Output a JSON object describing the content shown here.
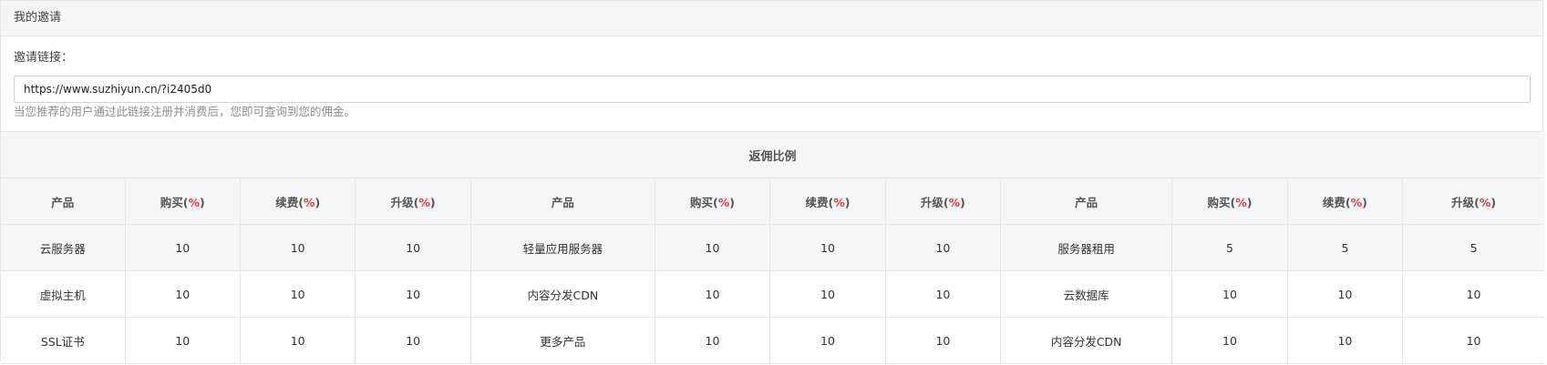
{
  "header": {
    "title": "我的邀请"
  },
  "invite": {
    "label": "邀请链接：",
    "link": "https://www.suzhiyun.cn/?i2405d0",
    "help": "当您推荐的用户通过此链接注册并消费后，您即可查询到您的佣金。"
  },
  "rebate_table": {
    "title": "返佣比例",
    "columns": {
      "product": "产品",
      "buy": "购买(",
      "renew": "续费(",
      "upgrade": "升级(",
      "pct_symbol": "%",
      "close": ")"
    },
    "rows": [
      [
        {
          "product": "云服务器",
          "buy": "10",
          "renew": "10",
          "upgrade": "10"
        },
        {
          "product": "轻量应用服务器",
          "buy": "10",
          "renew": "10",
          "upgrade": "10"
        },
        {
          "product": "服务器租用",
          "buy": "5",
          "renew": "5",
          "upgrade": "5"
        }
      ],
      [
        {
          "product": "虚拟主机",
          "buy": "10",
          "renew": "10",
          "upgrade": "10"
        },
        {
          "product": "内容分发CDN",
          "buy": "10",
          "renew": "10",
          "upgrade": "10"
        },
        {
          "product": "云数据库",
          "buy": "10",
          "renew": "10",
          "upgrade": "10"
        }
      ],
      [
        {
          "product": "SSL证书",
          "buy": "10",
          "renew": "10",
          "upgrade": "10"
        },
        {
          "product": "更多产品",
          "buy": "10",
          "renew": "10",
          "upgrade": "10"
        },
        {
          "product": "内容分发CDN",
          "buy": "10",
          "renew": "10",
          "upgrade": "10"
        }
      ]
    ]
  },
  "colors": {
    "accent_pct": "#e4393c",
    "header_bg": "#f5f6f8",
    "border": "#e4e6e9"
  }
}
